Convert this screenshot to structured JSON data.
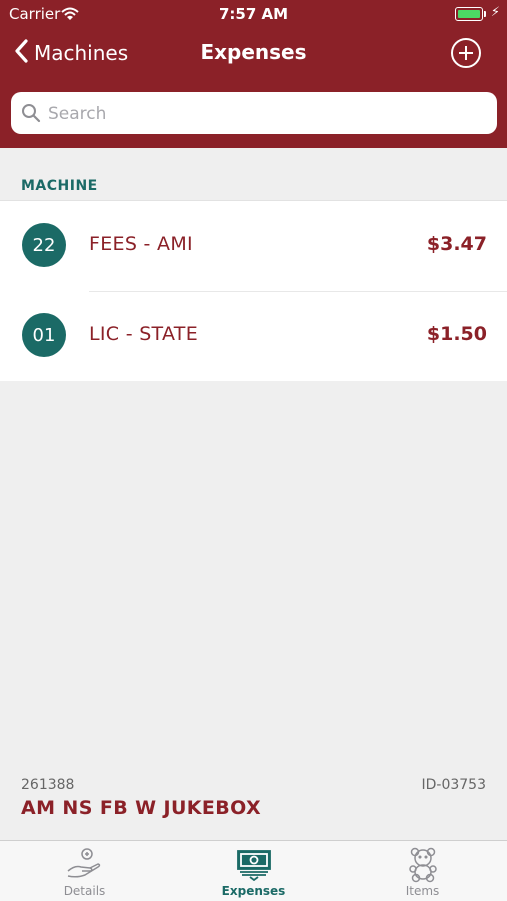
{
  "status_bar": {
    "carrier": "Carrier",
    "time": "7:57 AM"
  },
  "nav": {
    "back_label": "Machines",
    "title": "Expenses"
  },
  "search": {
    "placeholder": "Search",
    "value": ""
  },
  "section": {
    "header": "MACHINE"
  },
  "expenses": [
    {
      "number": "22",
      "name": "FEES - AMI",
      "amount": "$3.47"
    },
    {
      "number": "01",
      "name": "LIC - STATE",
      "amount": "$1.50"
    }
  ],
  "machine": {
    "code": "261388",
    "id": "ID-03753",
    "name": "AM NS FB W JUKEBOX"
  },
  "tabs": [
    {
      "label": "Details",
      "icon": "hand-coin-icon",
      "active": false
    },
    {
      "label": "Expenses",
      "icon": "cash-stack-icon",
      "active": true
    },
    {
      "label": "Items",
      "icon": "teddy-bear-icon",
      "active": false
    }
  ],
  "colors": {
    "brand": "#8b2128",
    "accent": "#1b6a66",
    "background": "#efefef"
  }
}
